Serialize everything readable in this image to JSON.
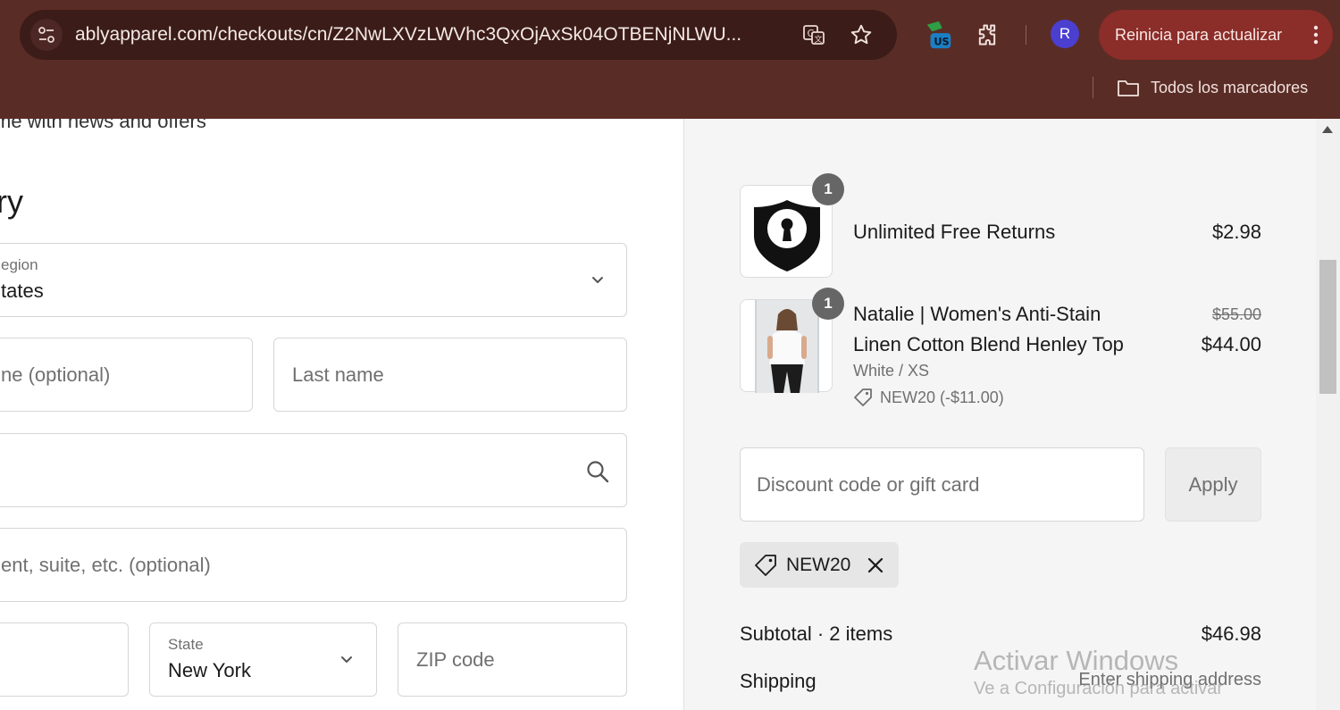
{
  "browser": {
    "url": "ablyapparel.com/checkouts/cn/Z2NwLXVzLWVhc3QxOjAxSk04OTBENjNLWU...",
    "restart_label": "Reinicia para actualizar",
    "bookmarks_label": "Todos los marcadores",
    "profile_initial": "R",
    "extension_badge": "US",
    "accent_color": "#5a2c26"
  },
  "form": {
    "newsletter_text": "me with news and offers",
    "section_heading": "ry",
    "country": {
      "label": "egion",
      "value": "tates"
    },
    "first_name_placeholder": "ne (optional)",
    "last_name_placeholder": "Last name",
    "apartment_placeholder": "ent, suite, etc. (optional)",
    "state": {
      "label": "State",
      "value": "New York"
    },
    "zip_placeholder": "ZIP code"
  },
  "summary": {
    "items": [
      {
        "name": "Unlimited Free Returns",
        "price": "$2.98",
        "quantity": "1"
      },
      {
        "name_line1": "Natalie | Women's Anti-Stain",
        "name_line2": "Linen Cotton Blend Henley Top",
        "original_price": "$55.00",
        "price": "$44.00",
        "variant": "White / XS",
        "discount": "NEW20 (-$11.00)",
        "quantity": "1"
      }
    ],
    "discount_placeholder": "Discount code or gift card",
    "apply_label": "Apply",
    "applied_code": "NEW20",
    "subtotal_label": "Subtotal · 2 items",
    "subtotal_value": "$46.98",
    "shipping_label": "Shipping",
    "shipping_value": "Enter shipping address"
  },
  "watermark": {
    "title": "Activar Windows",
    "subtitle": "Ve a Configuración para activar"
  }
}
